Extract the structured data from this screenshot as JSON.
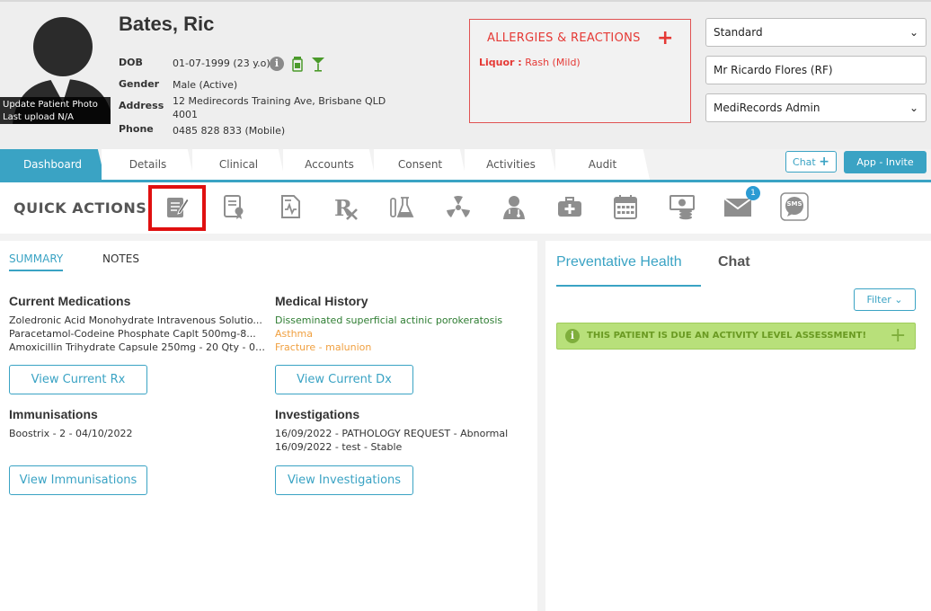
{
  "patient": {
    "name": "Bates, Ric",
    "photo_caption_1": "Update Patient Photo",
    "photo_caption_2": "Last upload N/A",
    "dob_label": "DOB",
    "dob_value": "01-07-1999 (23 y.o)",
    "gender_label": "Gender",
    "gender_value": "Male (Active)",
    "address_label": "Address",
    "address_line1": "12 Medirecords Training Ave, Brisbane QLD",
    "address_line2": "4001",
    "phone_label": "Phone",
    "phone_value": "0485 828 833 (Mobile)"
  },
  "allergies": {
    "title": "ALLERGIES & REACTIONS",
    "add_symbol": "+",
    "item_substance": "Liquor :",
    "item_reaction": "Rash (Mild)"
  },
  "selectors": {
    "fee_type": "Standard",
    "practitioner": "Mr Ricardo Flores (RF)",
    "user": "MediRecords Admin"
  },
  "tabs": [
    "Dashboard",
    "Details",
    "Clinical",
    "Accounts",
    "Consent",
    "Activities",
    "Audit"
  ],
  "chat_button": "Chat",
  "invite_button": "App - Invite",
  "quick_actions": {
    "title": "QUICK ACTIONS",
    "icons": [
      "note-edit-icon",
      "certificate-icon",
      "health-summary-icon",
      "prescription-icon",
      "pathology-icon",
      "radiology-icon",
      "referral-doctor-icon",
      "medical-kit-icon",
      "calendar-icon",
      "billing-icon",
      "mail-icon",
      "sms-icon"
    ],
    "mail_badge": "1",
    "sms_label": "SMS"
  },
  "summary": {
    "tab_summary": "SUMMARY",
    "tab_notes": "NOTES",
    "medications_title": "Current Medications",
    "medications": [
      "Zoledronic Acid Monohydrate Intravenous Solutio...",
      "Paracetamol-Codeine Phosphate Caplt 500mg-8...",
      "Amoxicillin Trihydrate Capsule 250mg - 20 Qty - 0 ..."
    ],
    "view_rx": "View Current Rx",
    "history_title": "Medical History",
    "history": [
      "Disseminated superficial actinic porokeratosis",
      "Asthma",
      "Fracture - malunion"
    ],
    "view_dx": "View Current Dx",
    "immunisations_title": "Immunisations",
    "immunisations": [
      "Boostrix - 2 - 04/10/2022"
    ],
    "view_immunisations": "View Immunisations",
    "investigations_title": "Investigations",
    "investigations": [
      "16/09/2022 - PATHOLOGY REQUEST - Abnormal",
      "16/09/2022 - test - Stable"
    ],
    "view_investigations": "View Investigations"
  },
  "right_panel": {
    "tab_preventative": "Preventative Health",
    "tab_chat": "Chat",
    "filter": "Filter",
    "alert_text": "THIS PATIENT IS DUE AN ACTIVITY LEVEL ASSESSMENT!"
  },
  "colors": {
    "accent": "#3aa3c4",
    "allergy_red": "#e53935",
    "alert_green": "#b8e07a",
    "highlight_red": "#e01010"
  }
}
